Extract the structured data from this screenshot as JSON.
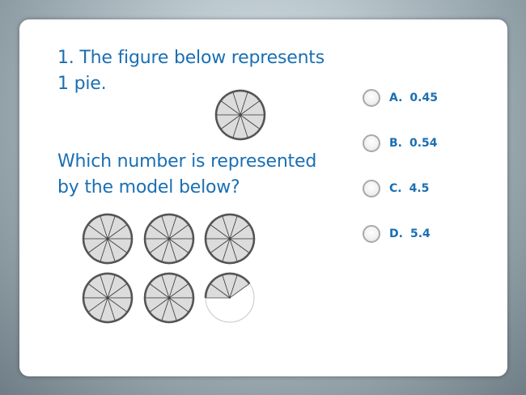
{
  "question": {
    "intro": "1. The figure below represents 1 pie.",
    "prompt": "Which number is represented by the model below?"
  },
  "reference_pie": {
    "slices": 10,
    "filled": 10
  },
  "model_pies": [
    {
      "slices": 10,
      "filled": 10
    },
    {
      "slices": 10,
      "filled": 10
    },
    {
      "slices": 10,
      "filled": 10
    },
    {
      "slices": 10,
      "filled": 10
    },
    {
      "slices": 10,
      "filled": 10
    },
    {
      "slices": 10,
      "filled": 4
    }
  ],
  "choices": [
    {
      "letter": "A.",
      "value": "0.45"
    },
    {
      "letter": "B.",
      "value": "0.54"
    },
    {
      "letter": "C.",
      "value": "4.5"
    },
    {
      "letter": "D.",
      "value": "5.4"
    }
  ],
  "colors": {
    "text": "#1a6fb3",
    "slice_fill": "#dcdcdc",
    "slice_stroke": "#444444",
    "rim": "#555555",
    "empty_outline": "#c8c8c8"
  }
}
